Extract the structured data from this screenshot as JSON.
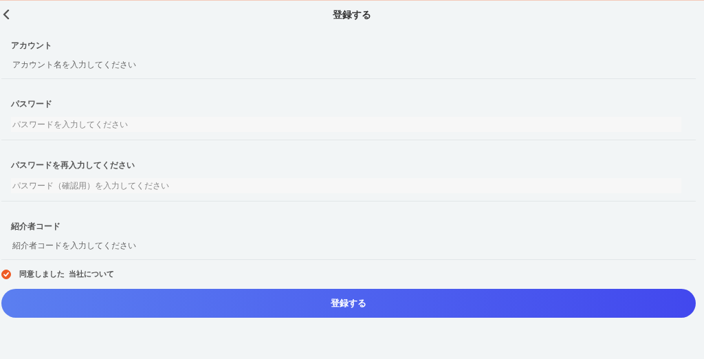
{
  "header": {
    "title": "登録する"
  },
  "fields": [
    {
      "label": "アカウント",
      "placeholder": "アカウント名を入力してください",
      "kind": "text"
    },
    {
      "label": "パスワード",
      "placeholder": "パスワードを入力してください",
      "kind": "password"
    },
    {
      "label": "パスワードを再入力してください",
      "placeholder": "パスワード（確認用）を入力してください",
      "kind": "password"
    },
    {
      "label": "紹介者コード",
      "placeholder": "紹介者コードを入力してください",
      "kind": "text"
    }
  ],
  "agreement": {
    "checked": true,
    "text": "同意しました",
    "link": "当社について"
  },
  "submit": {
    "label": "登録する"
  }
}
